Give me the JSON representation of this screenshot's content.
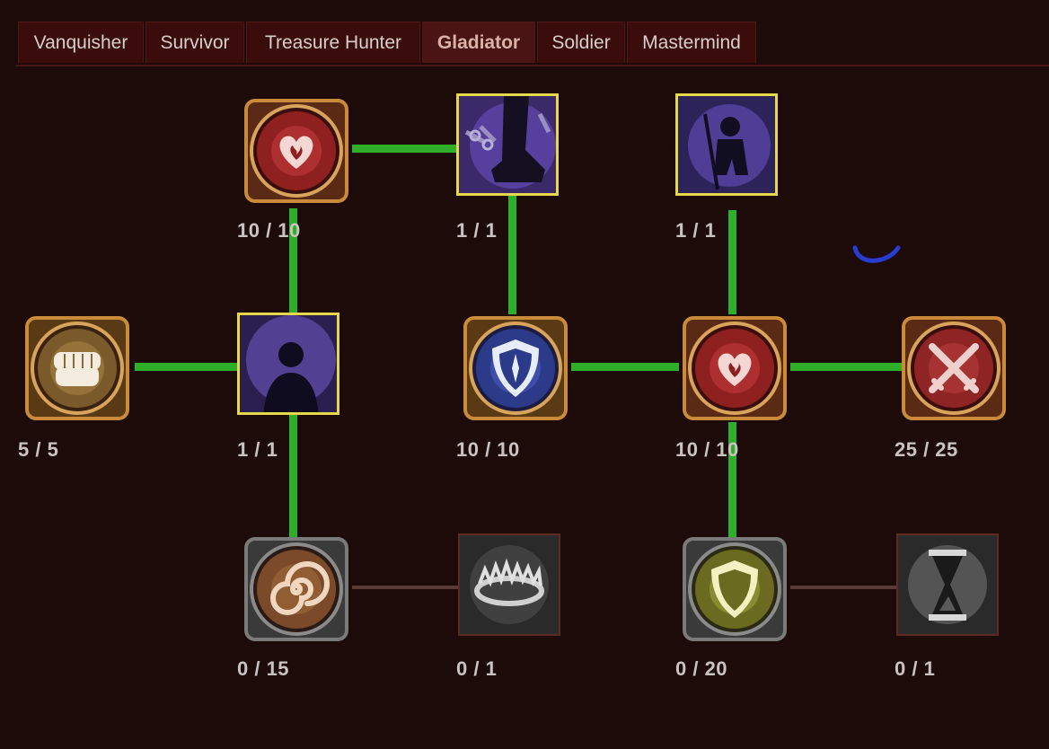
{
  "tabs": [
    {
      "label": "Vanquisher",
      "active": false
    },
    {
      "label": "Survivor",
      "active": false
    },
    {
      "label": "Treasure Hunter",
      "active": false
    },
    {
      "label": "Gladiator",
      "active": true
    },
    {
      "label": "Soldier",
      "active": false
    },
    {
      "label": "Mastermind",
      "active": false
    }
  ],
  "colors": {
    "background": "#1d0b0a",
    "tab_bg": "#3a0d0c",
    "active_link": "#2fae2a",
    "inactive_link": "#5a3a34",
    "selected_border": "#e6d84a"
  },
  "nodes": {
    "heart_top": {
      "icon": "heart-icon",
      "rank": "10 / 10"
    },
    "chain_boot": {
      "icon": "chained-boot-icon",
      "rank": "1 / 1"
    },
    "shadow_staff": {
      "icon": "shadow-warrior-icon",
      "rank": "1 / 1"
    },
    "fist": {
      "icon": "fist-icon",
      "rank": "5 / 5"
    },
    "shadow_aura": {
      "icon": "shadow-figure-icon",
      "rank": "1 / 1"
    },
    "blue_shield": {
      "icon": "shield-icon",
      "rank": "10 / 10"
    },
    "heart_mid": {
      "icon": "heart-icon",
      "rank": "10 / 10"
    },
    "crossed_swords": {
      "icon": "crossed-swords-icon",
      "rank": "25 / 25"
    },
    "spiral": {
      "icon": "spiral-icon",
      "rank": "0 / 15"
    },
    "bear_trap": {
      "icon": "bear-trap-icon",
      "rank": "0 / 1"
    },
    "gold_shield": {
      "icon": "shield-icon",
      "rank": "0 / 20"
    },
    "hourglass": {
      "icon": "hourglass-icon",
      "rank": "0 / 1"
    }
  }
}
